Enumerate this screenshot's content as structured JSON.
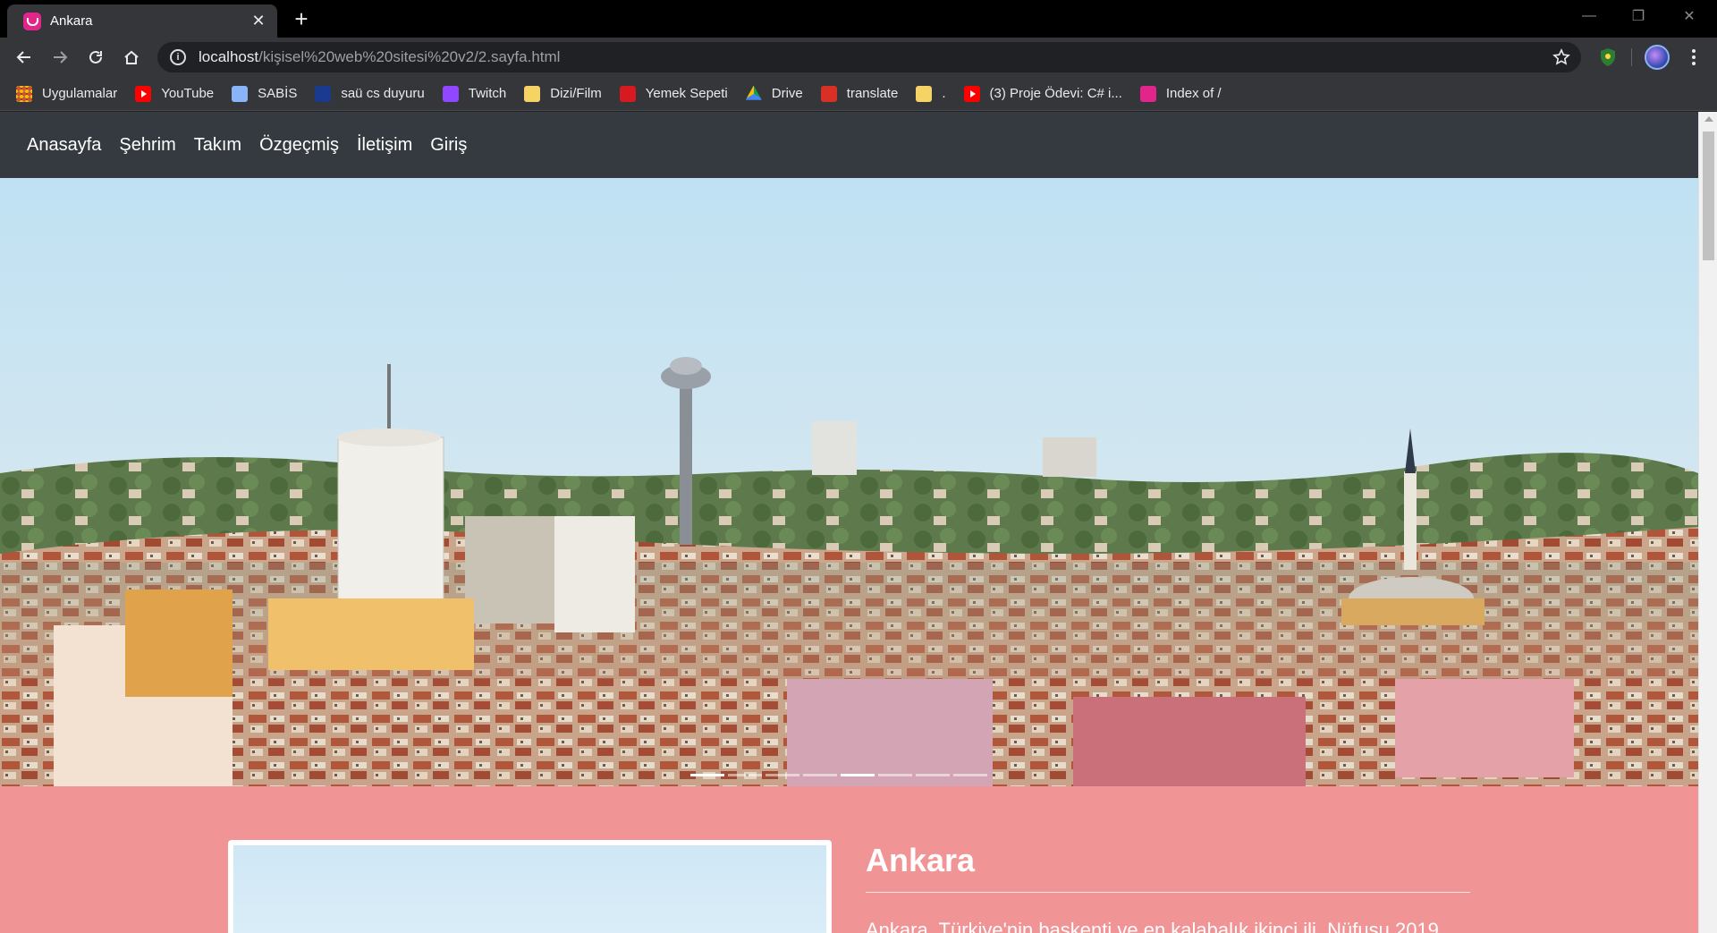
{
  "browser": {
    "tab_title": "Ankara",
    "url_host": "localhost",
    "url_path": "/kişisel%20web%20sitesi%20v2/2.sayfa.html",
    "bookmarks": [
      {
        "label": "Uygulamalar",
        "icon": "apps-icon"
      },
      {
        "label": "YouTube",
        "icon": "youtube-icon"
      },
      {
        "label": "SABİS",
        "icon": "document-icon"
      },
      {
        "label": "saü cs duyuru",
        "icon": "site-icon"
      },
      {
        "label": "Twitch",
        "icon": "twitch-icon"
      },
      {
        "label": "Dizi/Film",
        "icon": "folder-icon"
      },
      {
        "label": "Yemek Sepeti",
        "icon": "yemeksepeti-icon"
      },
      {
        "label": "Drive",
        "icon": "drive-icon"
      },
      {
        "label": "translate",
        "icon": "translate-icon"
      },
      {
        "label": ".",
        "icon": "folder-icon"
      },
      {
        "label": "(3) Proje Ödevi: C# i...",
        "icon": "youtube-icon"
      },
      {
        "label": "Index of /",
        "icon": "index-icon"
      }
    ]
  },
  "site": {
    "nav": [
      "Anasayfa",
      "Şehrim",
      "Takım",
      "Özgeçmiş",
      "İletişim",
      "Giriş"
    ],
    "carousel": {
      "slide_count": 8,
      "active_index": 0,
      "highlighted_index": 4
    },
    "section": {
      "title": "Ankara",
      "description": "Ankara, Türkiye'nin başkenti ve en kalabalık ikinci ili. Nüfusu 2019"
    }
  },
  "colors": {
    "navbar": "#343a40",
    "content_bg": "#f09496",
    "chrome_dark": "#35363a"
  }
}
